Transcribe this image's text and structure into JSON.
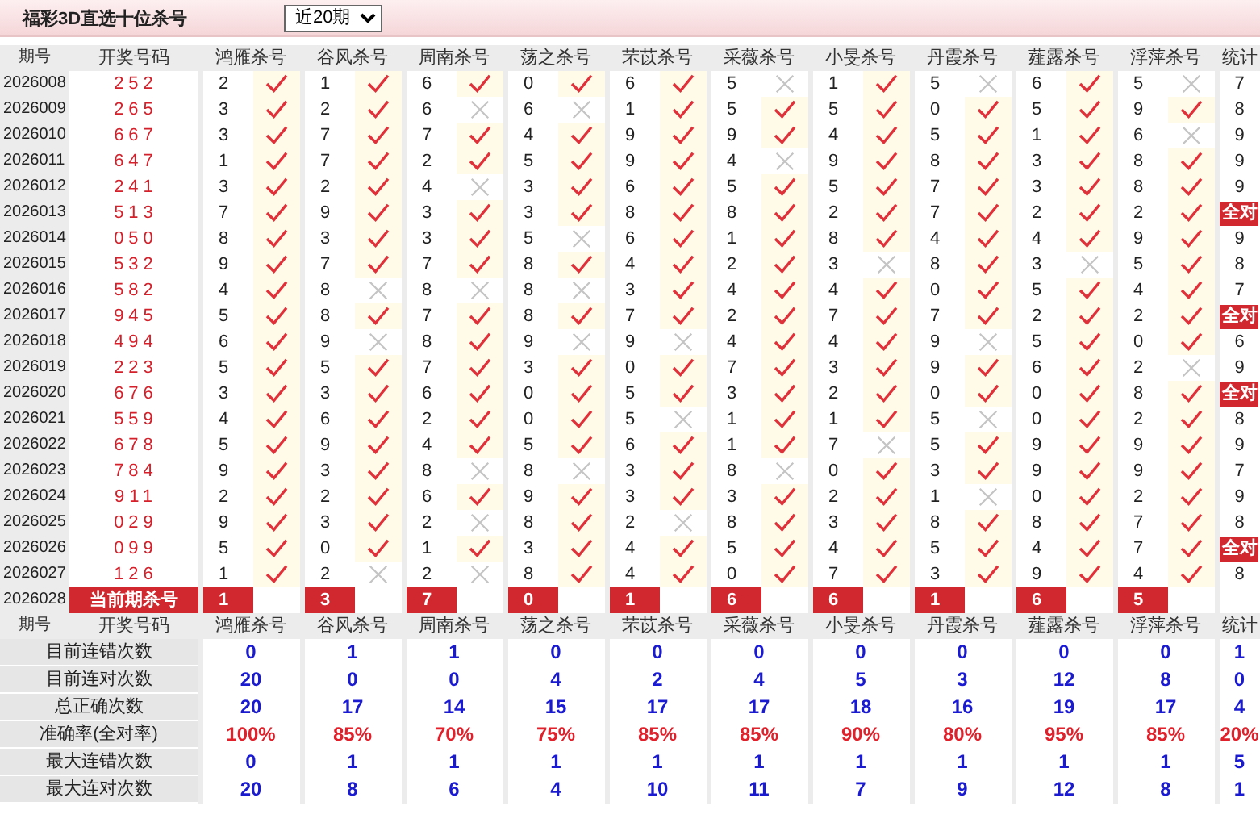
{
  "title": "福彩3D直选十位杀号",
  "period_select": {
    "value": "近20期"
  },
  "header": {
    "period": "期号",
    "draw": "开奖号码",
    "experts": [
      "鸿雁杀号",
      "谷风杀号",
      "周南杀号",
      "荡之杀号",
      "芣苡杀号",
      "采薇杀号",
      "小旻杀号",
      "丹霞杀号",
      "薤露杀号",
      "浮萍杀号"
    ],
    "stats": "统计"
  },
  "rows": [
    {
      "period": "2026008",
      "draw": "252",
      "kills": [
        {
          "number": "2",
          "hit": true
        },
        {
          "number": "1",
          "hit": true
        },
        {
          "number": "6",
          "hit": true
        },
        {
          "number": "0",
          "hit": true
        },
        {
          "number": "6",
          "hit": true
        },
        {
          "number": "5",
          "hit": false
        },
        {
          "number": "1",
          "hit": true
        },
        {
          "number": "5",
          "hit": false
        },
        {
          "number": "6",
          "hit": true
        },
        {
          "number": "5",
          "hit": false
        }
      ],
      "summary": {
        "kind": "count",
        "text": "7"
      }
    },
    {
      "period": "2026009",
      "draw": "265",
      "kills": [
        {
          "number": "3",
          "hit": true
        },
        {
          "number": "2",
          "hit": true
        },
        {
          "number": "6",
          "hit": false
        },
        {
          "number": "6",
          "hit": false
        },
        {
          "number": "1",
          "hit": true
        },
        {
          "number": "5",
          "hit": true
        },
        {
          "number": "5",
          "hit": true
        },
        {
          "number": "0",
          "hit": true
        },
        {
          "number": "5",
          "hit": true
        },
        {
          "number": "9",
          "hit": true
        }
      ],
      "summary": {
        "kind": "count",
        "text": "8"
      }
    },
    {
      "period": "2026010",
      "draw": "667",
      "kills": [
        {
          "number": "3",
          "hit": true
        },
        {
          "number": "7",
          "hit": true
        },
        {
          "number": "7",
          "hit": true
        },
        {
          "number": "4",
          "hit": true
        },
        {
          "number": "9",
          "hit": true
        },
        {
          "number": "9",
          "hit": true
        },
        {
          "number": "4",
          "hit": true
        },
        {
          "number": "5",
          "hit": true
        },
        {
          "number": "1",
          "hit": true
        },
        {
          "number": "6",
          "hit": false
        }
      ],
      "summary": {
        "kind": "count",
        "text": "9"
      }
    },
    {
      "period": "2026011",
      "draw": "647",
      "kills": [
        {
          "number": "1",
          "hit": true
        },
        {
          "number": "7",
          "hit": true
        },
        {
          "number": "2",
          "hit": true
        },
        {
          "number": "5",
          "hit": true
        },
        {
          "number": "9",
          "hit": true
        },
        {
          "number": "4",
          "hit": false
        },
        {
          "number": "9",
          "hit": true
        },
        {
          "number": "8",
          "hit": true
        },
        {
          "number": "3",
          "hit": true
        },
        {
          "number": "8",
          "hit": true
        }
      ],
      "summary": {
        "kind": "count",
        "text": "9"
      }
    },
    {
      "period": "2026012",
      "draw": "241",
      "kills": [
        {
          "number": "3",
          "hit": true
        },
        {
          "number": "2",
          "hit": true
        },
        {
          "number": "4",
          "hit": false
        },
        {
          "number": "3",
          "hit": true
        },
        {
          "number": "6",
          "hit": true
        },
        {
          "number": "5",
          "hit": true
        },
        {
          "number": "5",
          "hit": true
        },
        {
          "number": "7",
          "hit": true
        },
        {
          "number": "3",
          "hit": true
        },
        {
          "number": "8",
          "hit": true
        }
      ],
      "summary": {
        "kind": "count",
        "text": "9"
      }
    },
    {
      "period": "2026013",
      "draw": "513",
      "kills": [
        {
          "number": "7",
          "hit": true
        },
        {
          "number": "9",
          "hit": true
        },
        {
          "number": "3",
          "hit": true
        },
        {
          "number": "3",
          "hit": true
        },
        {
          "number": "8",
          "hit": true
        },
        {
          "number": "8",
          "hit": true
        },
        {
          "number": "2",
          "hit": true
        },
        {
          "number": "7",
          "hit": true
        },
        {
          "number": "2",
          "hit": true
        },
        {
          "number": "2",
          "hit": true
        }
      ],
      "summary": {
        "kind": "all_correct",
        "text": "全对"
      }
    },
    {
      "period": "2026014",
      "draw": "050",
      "kills": [
        {
          "number": "8",
          "hit": true
        },
        {
          "number": "3",
          "hit": true
        },
        {
          "number": "3",
          "hit": true
        },
        {
          "number": "5",
          "hit": false
        },
        {
          "number": "6",
          "hit": true
        },
        {
          "number": "1",
          "hit": true
        },
        {
          "number": "8",
          "hit": true
        },
        {
          "number": "4",
          "hit": true
        },
        {
          "number": "4",
          "hit": true
        },
        {
          "number": "9",
          "hit": true
        }
      ],
      "summary": {
        "kind": "count",
        "text": "9"
      }
    },
    {
      "period": "2026015",
      "draw": "532",
      "kills": [
        {
          "number": "9",
          "hit": true
        },
        {
          "number": "7",
          "hit": true
        },
        {
          "number": "7",
          "hit": true
        },
        {
          "number": "8",
          "hit": true
        },
        {
          "number": "4",
          "hit": true
        },
        {
          "number": "2",
          "hit": true
        },
        {
          "number": "3",
          "hit": false
        },
        {
          "number": "8",
          "hit": true
        },
        {
          "number": "3",
          "hit": false
        },
        {
          "number": "5",
          "hit": true
        }
      ],
      "summary": {
        "kind": "count",
        "text": "8"
      }
    },
    {
      "period": "2026016",
      "draw": "582",
      "kills": [
        {
          "number": "4",
          "hit": true
        },
        {
          "number": "8",
          "hit": false
        },
        {
          "number": "8",
          "hit": false
        },
        {
          "number": "8",
          "hit": false
        },
        {
          "number": "3",
          "hit": true
        },
        {
          "number": "4",
          "hit": true
        },
        {
          "number": "4",
          "hit": true
        },
        {
          "number": "0",
          "hit": true
        },
        {
          "number": "5",
          "hit": true
        },
        {
          "number": "4",
          "hit": true
        }
      ],
      "summary": {
        "kind": "count",
        "text": "7"
      }
    },
    {
      "period": "2026017",
      "draw": "945",
      "kills": [
        {
          "number": "5",
          "hit": true
        },
        {
          "number": "8",
          "hit": true
        },
        {
          "number": "7",
          "hit": true
        },
        {
          "number": "8",
          "hit": true
        },
        {
          "number": "7",
          "hit": true
        },
        {
          "number": "2",
          "hit": true
        },
        {
          "number": "7",
          "hit": true
        },
        {
          "number": "7",
          "hit": true
        },
        {
          "number": "2",
          "hit": true
        },
        {
          "number": "2",
          "hit": true
        }
      ],
      "summary": {
        "kind": "all_correct",
        "text": "全对"
      }
    },
    {
      "period": "2026018",
      "draw": "494",
      "kills": [
        {
          "number": "6",
          "hit": true
        },
        {
          "number": "9",
          "hit": false
        },
        {
          "number": "8",
          "hit": true
        },
        {
          "number": "9",
          "hit": false
        },
        {
          "number": "9",
          "hit": false
        },
        {
          "number": "4",
          "hit": true
        },
        {
          "number": "4",
          "hit": true
        },
        {
          "number": "9",
          "hit": false
        },
        {
          "number": "5",
          "hit": true
        },
        {
          "number": "0",
          "hit": true
        }
      ],
      "summary": {
        "kind": "count",
        "text": "6"
      }
    },
    {
      "period": "2026019",
      "draw": "223",
      "kills": [
        {
          "number": "5",
          "hit": true
        },
        {
          "number": "5",
          "hit": true
        },
        {
          "number": "7",
          "hit": true
        },
        {
          "number": "3",
          "hit": true
        },
        {
          "number": "0",
          "hit": true
        },
        {
          "number": "7",
          "hit": true
        },
        {
          "number": "3",
          "hit": true
        },
        {
          "number": "9",
          "hit": true
        },
        {
          "number": "6",
          "hit": true
        },
        {
          "number": "2",
          "hit": false
        }
      ],
      "summary": {
        "kind": "count",
        "text": "9"
      }
    },
    {
      "period": "2026020",
      "draw": "676",
      "kills": [
        {
          "number": "3",
          "hit": true
        },
        {
          "number": "3",
          "hit": true
        },
        {
          "number": "6",
          "hit": true
        },
        {
          "number": "0",
          "hit": true
        },
        {
          "number": "5",
          "hit": true
        },
        {
          "number": "3",
          "hit": true
        },
        {
          "number": "2",
          "hit": true
        },
        {
          "number": "0",
          "hit": true
        },
        {
          "number": "0",
          "hit": true
        },
        {
          "number": "8",
          "hit": true
        }
      ],
      "summary": {
        "kind": "all_correct",
        "text": "全对"
      }
    },
    {
      "period": "2026021",
      "draw": "559",
      "kills": [
        {
          "number": "4",
          "hit": true
        },
        {
          "number": "6",
          "hit": true
        },
        {
          "number": "2",
          "hit": true
        },
        {
          "number": "0",
          "hit": true
        },
        {
          "number": "5",
          "hit": false
        },
        {
          "number": "1",
          "hit": true
        },
        {
          "number": "1",
          "hit": true
        },
        {
          "number": "5",
          "hit": false
        },
        {
          "number": "0",
          "hit": true
        },
        {
          "number": "2",
          "hit": true
        }
      ],
      "summary": {
        "kind": "count",
        "text": "8"
      }
    },
    {
      "period": "2026022",
      "draw": "678",
      "kills": [
        {
          "number": "5",
          "hit": true
        },
        {
          "number": "9",
          "hit": true
        },
        {
          "number": "4",
          "hit": true
        },
        {
          "number": "5",
          "hit": true
        },
        {
          "number": "6",
          "hit": true
        },
        {
          "number": "1",
          "hit": true
        },
        {
          "number": "7",
          "hit": false
        },
        {
          "number": "5",
          "hit": true
        },
        {
          "number": "9",
          "hit": true
        },
        {
          "number": "9",
          "hit": true
        }
      ],
      "summary": {
        "kind": "count",
        "text": "9"
      }
    },
    {
      "period": "2026023",
      "draw": "784",
      "kills": [
        {
          "number": "9",
          "hit": true
        },
        {
          "number": "3",
          "hit": true
        },
        {
          "number": "8",
          "hit": false
        },
        {
          "number": "8",
          "hit": false
        },
        {
          "number": "3",
          "hit": true
        },
        {
          "number": "8",
          "hit": false
        },
        {
          "number": "0",
          "hit": true
        },
        {
          "number": "3",
          "hit": true
        },
        {
          "number": "9",
          "hit": true
        },
        {
          "number": "9",
          "hit": true
        }
      ],
      "summary": {
        "kind": "count",
        "text": "7"
      }
    },
    {
      "period": "2026024",
      "draw": "911",
      "kills": [
        {
          "number": "2",
          "hit": true
        },
        {
          "number": "2",
          "hit": true
        },
        {
          "number": "6",
          "hit": true
        },
        {
          "number": "9",
          "hit": true
        },
        {
          "number": "3",
          "hit": true
        },
        {
          "number": "3",
          "hit": true
        },
        {
          "number": "2",
          "hit": true
        },
        {
          "number": "1",
          "hit": false
        },
        {
          "number": "0",
          "hit": true
        },
        {
          "number": "2",
          "hit": true
        }
      ],
      "summary": {
        "kind": "count",
        "text": "9"
      }
    },
    {
      "period": "2026025",
      "draw": "029",
      "kills": [
        {
          "number": "9",
          "hit": true
        },
        {
          "number": "3",
          "hit": true
        },
        {
          "number": "2",
          "hit": false
        },
        {
          "number": "8",
          "hit": true
        },
        {
          "number": "2",
          "hit": false
        },
        {
          "number": "8",
          "hit": true
        },
        {
          "number": "3",
          "hit": true
        },
        {
          "number": "8",
          "hit": true
        },
        {
          "number": "8",
          "hit": true
        },
        {
          "number": "7",
          "hit": true
        }
      ],
      "summary": {
        "kind": "count",
        "text": "8"
      }
    },
    {
      "period": "2026026",
      "draw": "099",
      "kills": [
        {
          "number": "5",
          "hit": true
        },
        {
          "number": "0",
          "hit": true
        },
        {
          "number": "1",
          "hit": true
        },
        {
          "number": "3",
          "hit": true
        },
        {
          "number": "4",
          "hit": true
        },
        {
          "number": "5",
          "hit": true
        },
        {
          "number": "4",
          "hit": true
        },
        {
          "number": "5",
          "hit": true
        },
        {
          "number": "4",
          "hit": true
        },
        {
          "number": "7",
          "hit": true
        }
      ],
      "summary": {
        "kind": "all_correct",
        "text": "全对"
      }
    },
    {
      "period": "2026027",
      "draw": "126",
      "kills": [
        {
          "number": "1",
          "hit": true
        },
        {
          "number": "2",
          "hit": false
        },
        {
          "number": "2",
          "hit": false
        },
        {
          "number": "8",
          "hit": true
        },
        {
          "number": "4",
          "hit": true
        },
        {
          "number": "0",
          "hit": true
        },
        {
          "number": "7",
          "hit": true
        },
        {
          "number": "3",
          "hit": true
        },
        {
          "number": "9",
          "hit": true
        },
        {
          "number": "4",
          "hit": true
        }
      ],
      "summary": {
        "kind": "count",
        "text": "8"
      }
    }
  ],
  "current": {
    "period": "2026028",
    "label": "当前期杀号",
    "picks": [
      "1",
      "3",
      "7",
      "0",
      "1",
      "6",
      "6",
      "1",
      "6",
      "5"
    ]
  },
  "footer_header": {
    "period": "期号",
    "draw": "开奖号码",
    "experts": [
      "鸿雁杀号",
      "谷风杀号",
      "周南杀号",
      "荡之杀号",
      "芣苡杀号",
      "采薇杀号",
      "小旻杀号",
      "丹霞杀号",
      "薤露杀号",
      "浮萍杀号"
    ],
    "stats": "统计"
  },
  "stats_rows": [
    {
      "label": "目前连错次数",
      "kind": "count",
      "values": [
        "0",
        "1",
        "1",
        "0",
        "0",
        "0",
        "0",
        "0",
        "0",
        "0",
        "1"
      ]
    },
    {
      "label": "目前连对次数",
      "kind": "count",
      "values": [
        "20",
        "0",
        "0",
        "4",
        "2",
        "4",
        "5",
        "3",
        "12",
        "8",
        "0"
      ]
    },
    {
      "label": "总正确次数",
      "kind": "count",
      "values": [
        "20",
        "17",
        "14",
        "15",
        "17",
        "17",
        "18",
        "16",
        "19",
        "17",
        "4"
      ]
    },
    {
      "label": "准确率(全对率)",
      "kind": "rate",
      "values": [
        "100%",
        "85%",
        "70%",
        "75%",
        "85%",
        "85%",
        "90%",
        "80%",
        "95%",
        "85%",
        "20%"
      ]
    },
    {
      "label": "最大连错次数",
      "kind": "count",
      "values": [
        "0",
        "1",
        "1",
        "1",
        "1",
        "1",
        "1",
        "1",
        "1",
        "1",
        "5"
      ]
    },
    {
      "label": "最大连对次数",
      "kind": "count",
      "values": [
        "20",
        "8",
        "6",
        "4",
        "10",
        "11",
        "7",
        "9",
        "12",
        "8",
        "1"
      ]
    }
  ]
}
